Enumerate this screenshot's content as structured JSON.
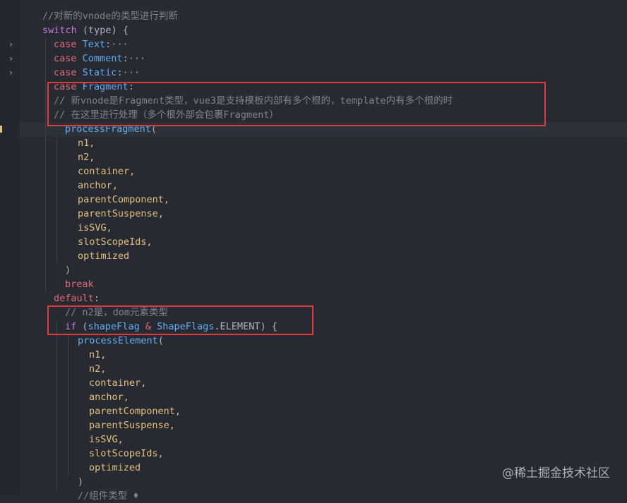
{
  "editor": {
    "comment_header": "//对新的vnode的类型进行判断",
    "switch_kw": "switch",
    "switch_arg": "(type) {",
    "cases": [
      {
        "kw": "case",
        "name": "Text",
        "rest": ":",
        "fold": "···"
      },
      {
        "kw": "case",
        "name": "Comment",
        "rest": ":",
        "fold": "···"
      },
      {
        "kw": "case",
        "name": "Static",
        "rest": ":",
        "fold": "···"
      }
    ],
    "fragment_case": {
      "kw": "case",
      "name": "Fragment",
      "rest": ":"
    },
    "fragment_comments": [
      "// 新vnode是Fragment类型，vue3是支持模板内部有多个根的，template内有多个根的时",
      "// 在这里进行处理（多个根外部会包裹Fragment）"
    ],
    "process_fragment": "processFragment",
    "fragment_args": [
      "n1,",
      "n2,",
      "container,",
      "anchor,",
      "parentComponent,",
      "parentSuspense,",
      "isSVG,",
      "slotScopeIds,",
      "optimized"
    ],
    "close_paren": ")",
    "break_kw": "break",
    "default_kw": "default",
    "default_colon": ":",
    "default_comment": "// n2是，dom元素类型",
    "if_kw": "if",
    "if_open": "(",
    "shape_flag": "shapeFlag",
    "amp": "&",
    "shape_flags": "ShapeFlags",
    "element_const": ".ELEMENT",
    "if_close": ") {",
    "process_element": "processElement",
    "paren_open": "(",
    "element_args": [
      "n1,",
      "n2,",
      "container,",
      "anchor,",
      "parentComponent,",
      "parentSuspense,",
      "isSVG,",
      "slotScopeIds,",
      "optimized"
    ],
    "element_close": ")",
    "bottom_comment": "//组件类型 ♦"
  },
  "watermark": "@稀土掘金技术社区",
  "colors": {
    "highlight_box": "#e5383b",
    "background": "#272a32"
  }
}
